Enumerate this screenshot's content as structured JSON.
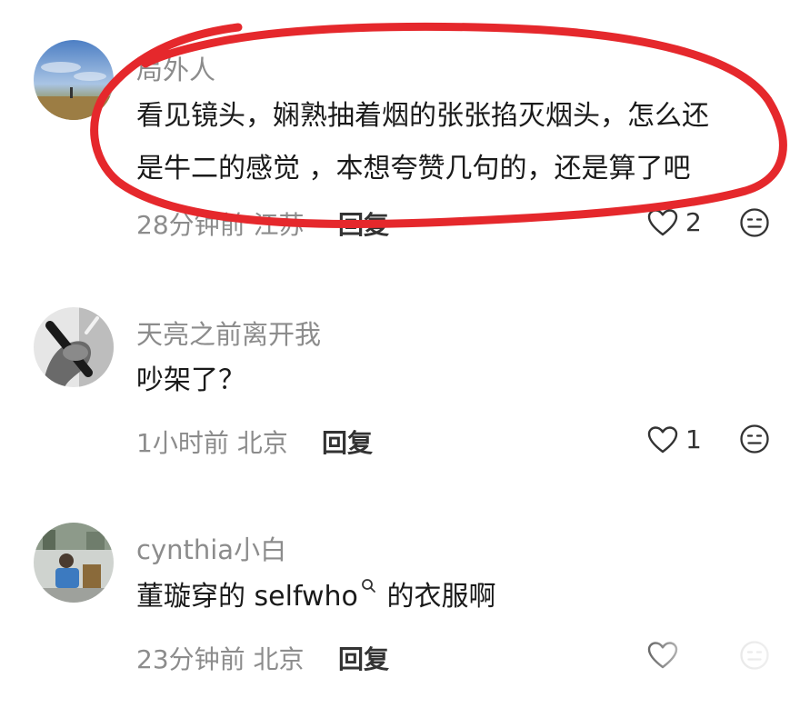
{
  "comments": [
    {
      "username": "局外人",
      "text_line1": "看见镜头，娴熟抽着烟的张张掐灭烟头，怎么还",
      "text_line2": "是牛二的感觉 ，本想夸赞几句的，还是算了吧",
      "time": "28分钟前",
      "location": "江苏",
      "reply_label": "回复",
      "likes": "2"
    },
    {
      "username": "天亮之前离开我",
      "text_line1": "吵架了？",
      "time": "1小时前",
      "location": "北京",
      "reply_label": "回复",
      "likes": "1"
    },
    {
      "username": "cynthia小白",
      "text_before": "董璇穿的 selfwho",
      "text_after": " 的衣服啊",
      "time": "23分钟前",
      "location": "北京",
      "reply_label": "回复"
    }
  ],
  "colors": {
    "scribble": "#e5282c",
    "meta": "#8c8c8c",
    "text": "#1a1a1a"
  },
  "icons": {
    "like": "heart-outline-icon",
    "dislike": "meh-face-icon",
    "search": "search-icon"
  }
}
